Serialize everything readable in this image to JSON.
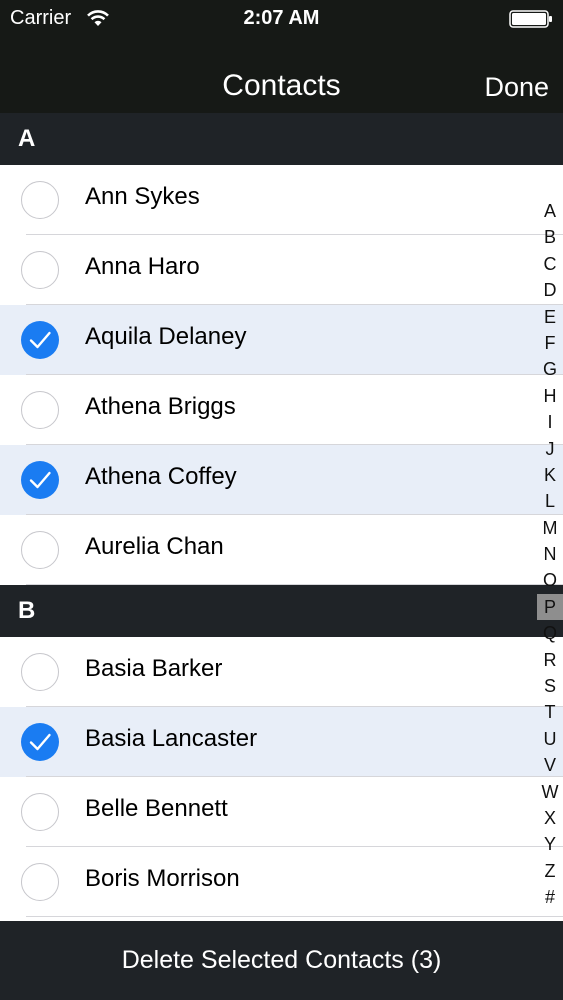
{
  "status_bar": {
    "carrier": "Carrier",
    "time": "2:07 AM"
  },
  "nav": {
    "title": "Contacts",
    "done_label": "Done"
  },
  "sections": [
    {
      "letter": "A",
      "contacts": [
        {
          "name": "Ann Sykes",
          "selected": false
        },
        {
          "name": "Anna Haro",
          "selected": false
        },
        {
          "name": "Aquila Delaney",
          "selected": true
        },
        {
          "name": "Athena Briggs",
          "selected": false
        },
        {
          "name": "Athena Coffey",
          "selected": true
        },
        {
          "name": "Aurelia Chan",
          "selected": false
        }
      ]
    },
    {
      "letter": "B",
      "contacts": [
        {
          "name": "Basia Barker",
          "selected": false
        },
        {
          "name": "Basia Lancaster",
          "selected": true
        },
        {
          "name": "Belle Bennett",
          "selected": false
        },
        {
          "name": "Boris Morrison",
          "selected": false
        }
      ]
    }
  ],
  "index_letters": [
    "A",
    "B",
    "C",
    "D",
    "E",
    "F",
    "G",
    "H",
    "I",
    "J",
    "K",
    "L",
    "M",
    "N",
    "O",
    "P",
    "Q",
    "R",
    "S",
    "T",
    "U",
    "V",
    "W",
    "X",
    "Y",
    "Z",
    "#"
  ],
  "index_highlighted": "P",
  "footer": {
    "delete_label": "Delete Selected Contacts (3)"
  },
  "colors": {
    "accent": "#1a7cf2",
    "bar_background": "#1f2327",
    "selected_row": "#e8eef8"
  }
}
